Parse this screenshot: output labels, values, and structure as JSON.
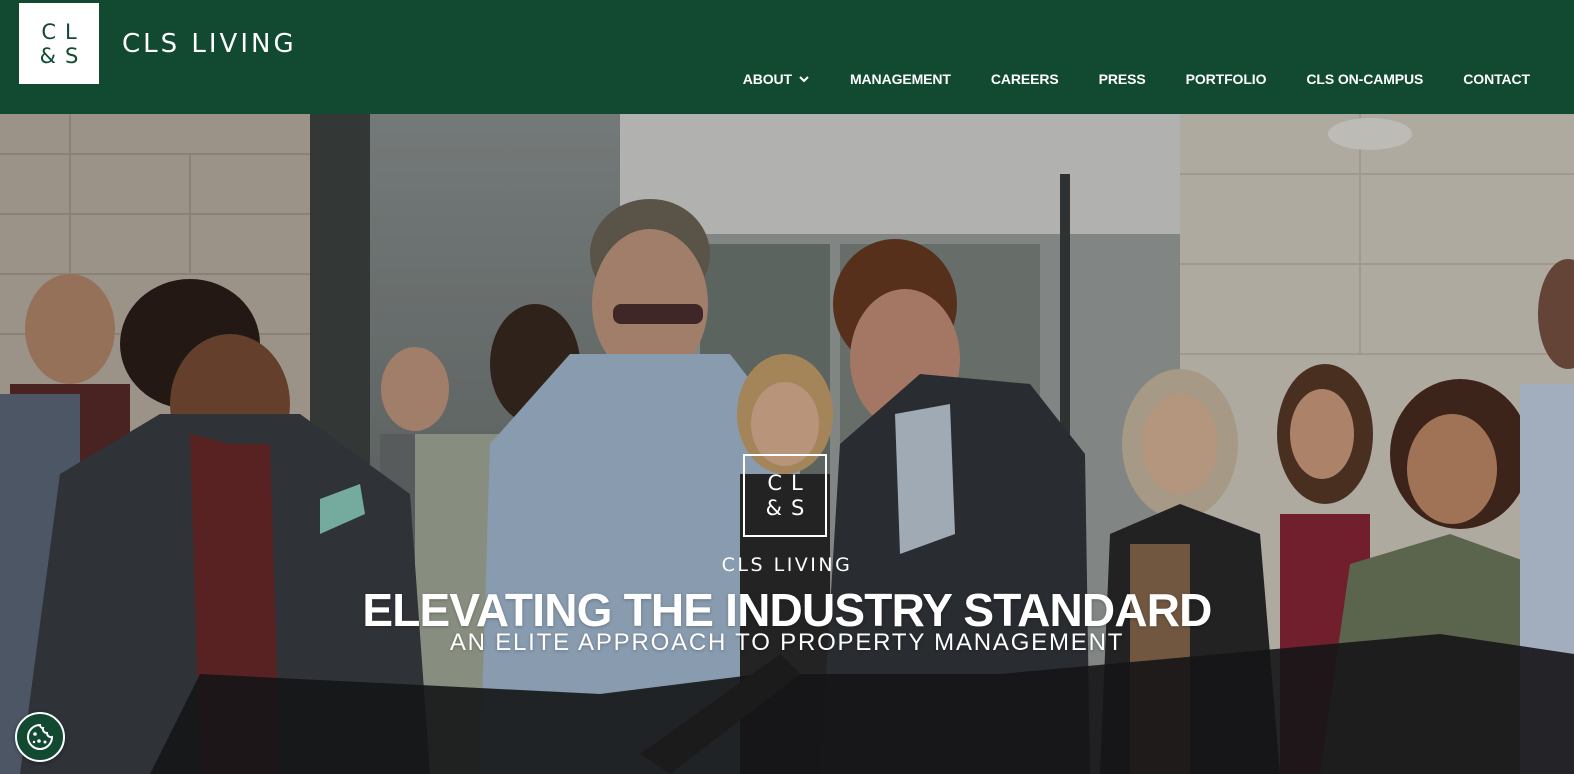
{
  "header": {
    "logo_mark": {
      "line1": "CL",
      "line2": "&S"
    },
    "brand_name": "CLS LIVING",
    "nav": [
      {
        "label": "ABOUT",
        "has_dropdown": true
      },
      {
        "label": "MANAGEMENT"
      },
      {
        "label": "CAREERS"
      },
      {
        "label": "PRESS"
      },
      {
        "label": "PORTFOLIO"
      },
      {
        "label": "CLS ON-CAMPUS"
      },
      {
        "label": "CONTACT"
      }
    ]
  },
  "hero": {
    "logo_mark": {
      "line1": "CL",
      "line2": "&S"
    },
    "brand": "CLS LIVING",
    "title": "ELEVATING THE INDUSTRY STANDARD",
    "subtitle": "AN ELITE APPROACH TO PROPERTY MANAGEMENT",
    "image_icon": "ribbon-cutting-photo"
  },
  "cookie_button": {
    "icon": "cookie-icon"
  },
  "colors": {
    "brand_green": "#114a31",
    "text_white": "#ffffff"
  }
}
